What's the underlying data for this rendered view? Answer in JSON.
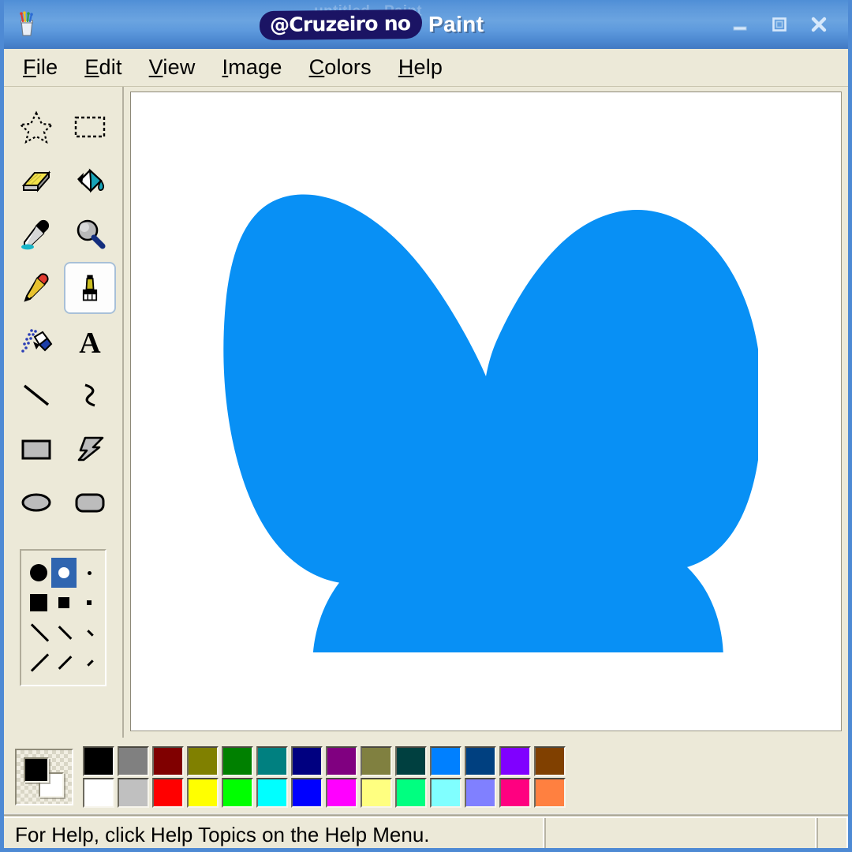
{
  "window": {
    "title_sticker": "@Cruzeiro no",
    "title_text": "Paint",
    "ghost_title": "untitled - Paint",
    "icon": "paint-cup-icon",
    "controls": [
      {
        "name": "minimize-button",
        "glyph": "minimize-icon",
        "label": "Minimize"
      },
      {
        "name": "maximize-button",
        "glyph": "maximize-icon",
        "label": "Maximize"
      },
      {
        "name": "close-button",
        "glyph": "close-icon",
        "label": "Close"
      }
    ]
  },
  "menu": {
    "items": [
      {
        "accel": "F",
        "rest": "ile",
        "label": "File"
      },
      {
        "accel": "E",
        "rest": "dit",
        "label": "Edit"
      },
      {
        "accel": "V",
        "rest": "iew",
        "label": "View"
      },
      {
        "accel": "I",
        "rest": "mage",
        "label": "Image"
      },
      {
        "accel": "C",
        "rest": "olors",
        "label": "Colors"
      },
      {
        "accel": "H",
        "rest": "elp",
        "label": "Help"
      }
    ]
  },
  "toolbox": {
    "tools": [
      {
        "name": "free-form-select-tool",
        "label": "Free-Form Select",
        "selected": false
      },
      {
        "name": "rectangle-select-tool",
        "label": "Select",
        "selected": false
      },
      {
        "name": "eraser-tool",
        "label": "Eraser/Color Eraser",
        "selected": false
      },
      {
        "name": "fill-tool",
        "label": "Fill With Color",
        "selected": false
      },
      {
        "name": "color-picker-tool",
        "label": "Pick Color",
        "selected": false
      },
      {
        "name": "magnifier-tool",
        "label": "Magnifier",
        "selected": false
      },
      {
        "name": "pencil-tool",
        "label": "Pencil",
        "selected": false
      },
      {
        "name": "brush-tool",
        "label": "Brush",
        "selected": true
      },
      {
        "name": "airbrush-tool",
        "label": "Airbrush",
        "selected": false
      },
      {
        "name": "text-tool",
        "label": "Text",
        "selected": false
      },
      {
        "name": "line-tool",
        "label": "Line",
        "selected": false
      },
      {
        "name": "curve-tool",
        "label": "Curve",
        "selected": false
      },
      {
        "name": "rectangle-tool",
        "label": "Rectangle",
        "selected": false
      },
      {
        "name": "polygon-tool",
        "label": "Polygon",
        "selected": false
      },
      {
        "name": "ellipse-tool",
        "label": "Ellipse",
        "selected": false
      },
      {
        "name": "rounded-rectangle-tool",
        "label": "Rounded Rectangle",
        "selected": false
      }
    ],
    "brush_shapes": [
      {
        "name": "brush-shape-circle-large",
        "kind": "dot-lg",
        "selected": false
      },
      {
        "name": "brush-shape-circle-medium",
        "kind": "dot-md",
        "selected": true
      },
      {
        "name": "brush-shape-circle-small",
        "kind": "dot-sm",
        "selected": false
      },
      {
        "name": "brush-shape-square-large",
        "kind": "sq-lg",
        "selected": false
      },
      {
        "name": "brush-shape-square-medium",
        "kind": "sq-md",
        "selected": false
      },
      {
        "name": "brush-shape-square-small",
        "kind": "sq-sm",
        "selected": false
      },
      {
        "name": "brush-shape-fslash-large",
        "kind": "fw-lg",
        "selected": false
      },
      {
        "name": "brush-shape-fslash-medium",
        "kind": "fw-md",
        "selected": false
      },
      {
        "name": "brush-shape-fslash-small",
        "kind": "fw-sm",
        "selected": false
      },
      {
        "name": "brush-shape-bslash-large",
        "kind": "bw-lg",
        "selected": false
      },
      {
        "name": "brush-shape-bslash-medium",
        "kind": "bw-md",
        "selected": false
      },
      {
        "name": "brush-shape-bslash-small",
        "kind": "bw-sm",
        "selected": false
      }
    ]
  },
  "canvas": {
    "background": "#ffffff",
    "drawing": {
      "name": "butterfly-shape",
      "description": "butterfly silhouette",
      "fill": "#0890f5"
    }
  },
  "palette": {
    "foreground": "#000000",
    "background": "#ffffff",
    "colors_top": [
      "#000000",
      "#808080",
      "#800000",
      "#808000",
      "#008000",
      "#008080",
      "#000080",
      "#800080",
      "#808040",
      "#004040",
      "#0080ff",
      "#004080",
      "#8000ff",
      "#804000"
    ],
    "colors_bottom": [
      "#ffffff",
      "#c0c0c0",
      "#ff0000",
      "#ffff00",
      "#00ff00",
      "#00ffff",
      "#0000ff",
      "#ff00ff",
      "#ffff80",
      "#00ff80",
      "#80ffff",
      "#8080ff",
      "#ff0080",
      "#ff8040"
    ]
  },
  "status_bar": {
    "help_text": "For Help, click Help Topics on the Help Menu.",
    "position_text": "",
    "size_text": ""
  }
}
